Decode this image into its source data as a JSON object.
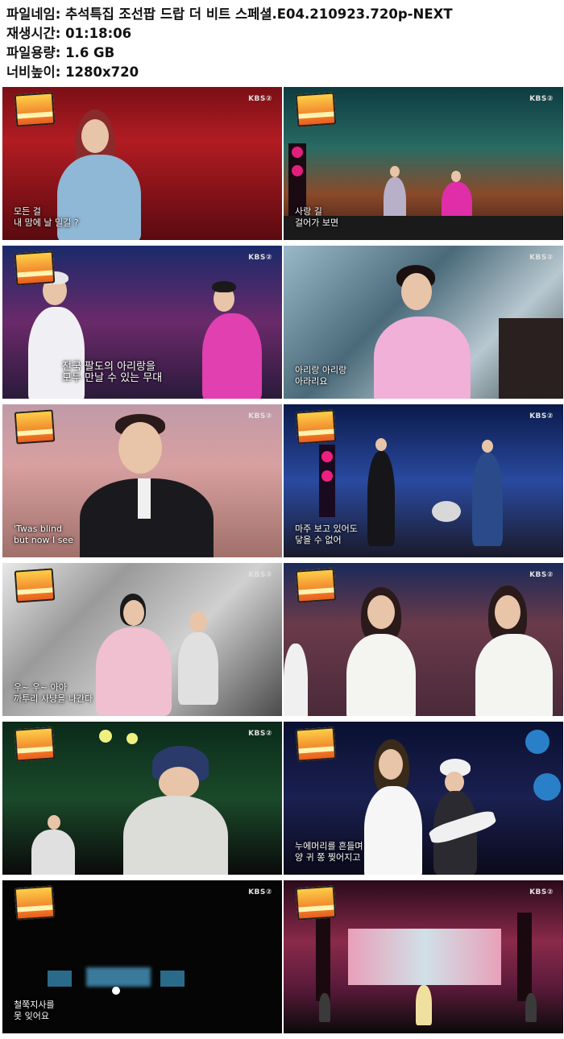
{
  "meta": {
    "filename_label": "파일네임:",
    "filename_value": "추석특집 조선팝 드랍 더 비트 스페셜.E04.210923.720p-NEXT",
    "runtime_label": "재생시간:",
    "runtime_value": "01:18:06",
    "size_label": "파일용량:",
    "size_value": "1.6 GB",
    "resolution_label": "너비높이:",
    "resolution_value": "1280x720"
  },
  "channel": "KBS②",
  "thumbnails": [
    {
      "caption": "모든 걸\n내 맘에 날 밀길 ?"
    },
    {
      "caption": "사랑 길\n걸어가 보면"
    },
    {
      "caption": "전국 팔도의 아리랑을\n모두 만날 수 있는 무대"
    },
    {
      "caption": "아리랑 아리랑\n아라리요"
    },
    {
      "caption": "'Twas blind\nbut now I see"
    },
    {
      "caption": "마주 보고 있어도\n닿을 수 없어"
    },
    {
      "caption": "우~ 우~ 아아\n까투리 사냥을 나간다"
    },
    {
      "caption": ""
    },
    {
      "caption": ""
    },
    {
      "caption": "누에머리를 흔들며\n양 귀 쫑 찢어지고"
    },
    {
      "caption": "철쭉지사를\n못 잊어요"
    },
    {
      "caption": ""
    }
  ]
}
